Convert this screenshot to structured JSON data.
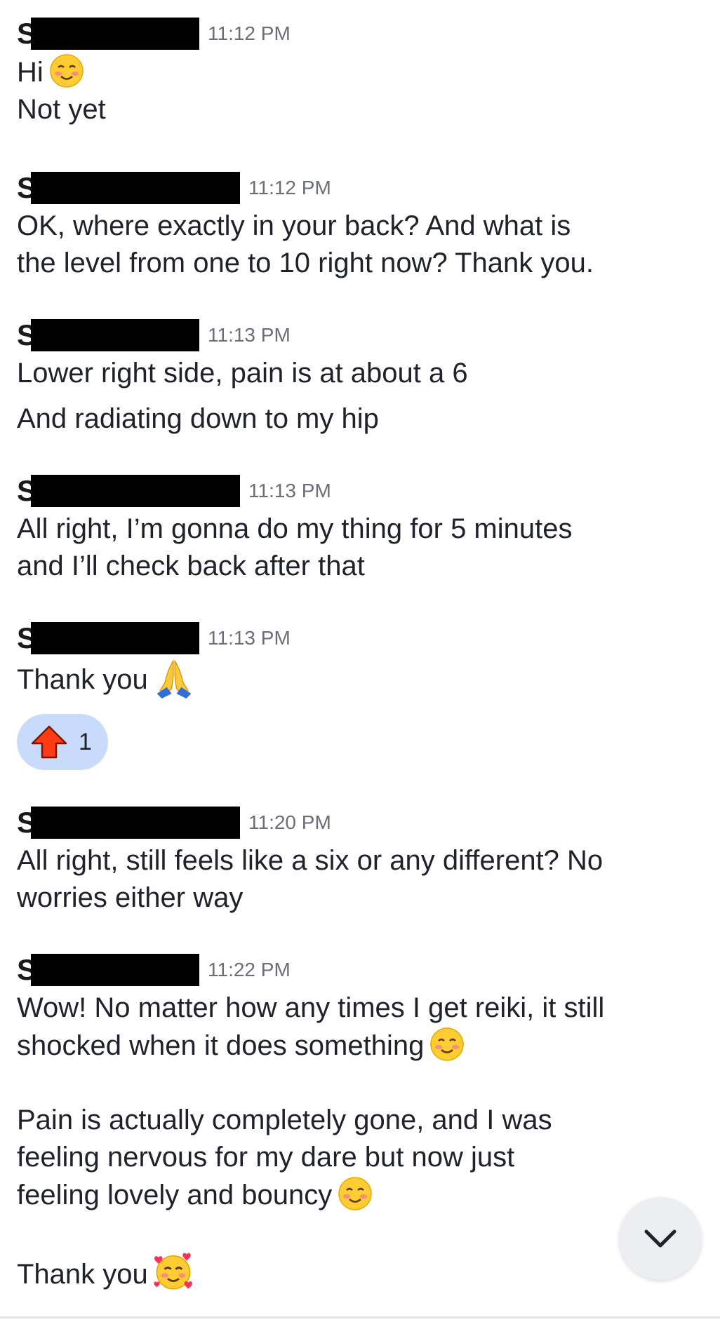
{
  "messages": [
    {
      "sender_initial": "S",
      "time": "11:12 PM",
      "lines": [
        "Hi",
        "Not yet"
      ]
    },
    {
      "sender_initial": "S",
      "time": "11:12 PM",
      "lines": [
        "OK, where exactly in your back? And what is",
        "the level from one to 10 right now? Thank you."
      ]
    },
    {
      "sender_initial": "S",
      "time": "11:13 PM",
      "lines": [
        "Lower right side, pain is at about a 6",
        "And radiating down to my hip"
      ]
    },
    {
      "sender_initial": "S",
      "time": "11:13 PM",
      "lines": [
        "All right, I’m gonna do my thing for 5 minutes",
        "and I’ll check back after that"
      ]
    },
    {
      "sender_initial": "S",
      "time": "11:13 PM",
      "lines": [
        "Thank you"
      ]
    },
    {
      "sender_initial": "S",
      "time": "11:20 PM",
      "lines": [
        "All right, still feels like a six or any different? No",
        "worries either way"
      ]
    },
    {
      "sender_initial": "S",
      "time": "11:22 PM",
      "lines": [
        "Wow! No matter how any times I get reiki, it still",
        "shocked when it does something",
        "",
        "Pain is actually completely gone, and I was",
        "feeling nervous for my dare but now just",
        "feeling lovely and bouncy",
        "",
        "Thank you"
      ]
    }
  ],
  "reaction": {
    "icon": "up-arrow-icon",
    "count": "1"
  },
  "scroll_button": {
    "icon": "chevron-down-icon"
  },
  "colors": {
    "text": "#1f2329",
    "timestamp": "#6b6f75",
    "reaction_bg": "#c9dbfb",
    "reaction_arrow": "#ff3b14",
    "scroll_bg": "#eceef1"
  }
}
